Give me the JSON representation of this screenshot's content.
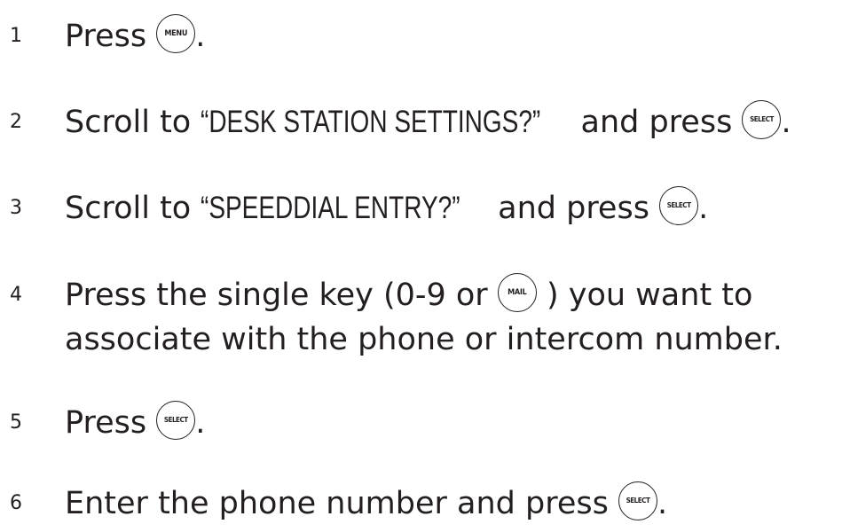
{
  "steps": [
    {
      "number": "1",
      "parts": [
        "Press",
        "."
      ],
      "keys": [
        "MENU"
      ]
    },
    {
      "number": "2",
      "parts": [
        "Scroll to ",
        "“DESK STATION SETTINGS?”",
        " and press",
        "."
      ],
      "keys": [
        "SELECT"
      ]
    },
    {
      "number": "3",
      "parts": [
        "Scroll to ",
        "“SPEEDDIAL ENTRY?”",
        " and press",
        "."
      ],
      "keys": [
        "SELECT"
      ]
    },
    {
      "number": "4",
      "parts": [
        "Press the single key (0-9 or",
        ") you want to",
        "associate with the phone or intercom number."
      ],
      "keys": [
        "MAIL"
      ]
    },
    {
      "number": "5",
      "parts": [
        "Press",
        "."
      ],
      "keys": [
        "SELECT"
      ]
    },
    {
      "number": "6",
      "parts": [
        "Enter the phone number and press",
        "."
      ],
      "keys": [
        "SELECT"
      ]
    }
  ]
}
